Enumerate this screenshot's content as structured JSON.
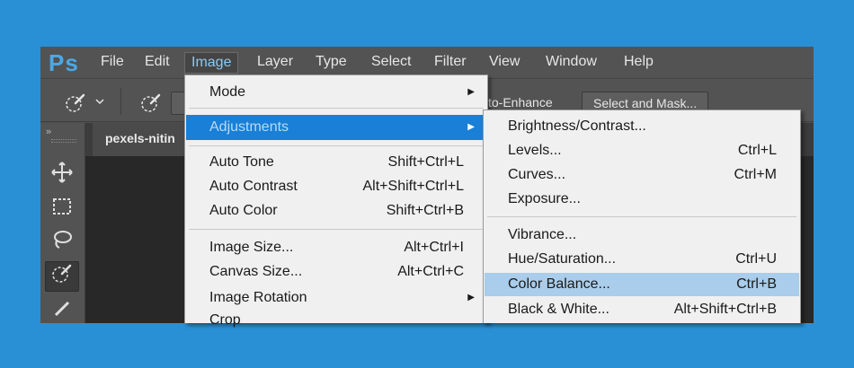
{
  "app": {
    "logo": "Ps"
  },
  "menubar": {
    "items": [
      "File",
      "Edit",
      "Image",
      "Layer",
      "Type",
      "Select",
      "Filter",
      "View",
      "Window",
      "Help"
    ],
    "active": "Image"
  },
  "options_bar": {
    "auto_enhance_partial": "to-Enhance",
    "select_and_mask": "Select and Mask..."
  },
  "document": {
    "tab_title": "pexels-nitin"
  },
  "image_menu": {
    "mode": "Mode",
    "adjustments": "Adjustments",
    "auto_tone": {
      "label": "Auto Tone",
      "shortcut": "Shift+Ctrl+L"
    },
    "auto_contrast": {
      "label": "Auto Contrast",
      "shortcut": "Alt+Shift+Ctrl+L"
    },
    "auto_color": {
      "label": "Auto Color",
      "shortcut": "Shift+Ctrl+B"
    },
    "image_size": {
      "label": "Image Size...",
      "shortcut": "Alt+Ctrl+I"
    },
    "canvas_size": {
      "label": "Canvas Size...",
      "shortcut": "Alt+Ctrl+C"
    },
    "image_rotation": "Image Rotation",
    "crop": "Crop"
  },
  "adjustments_menu": {
    "brightness_contrast": {
      "label": "Brightness/Contrast...",
      "shortcut": ""
    },
    "levels": {
      "label": "Levels...",
      "shortcut": "Ctrl+L"
    },
    "curves": {
      "label": "Curves...",
      "shortcut": "Ctrl+M"
    },
    "exposure": {
      "label": "Exposure...",
      "shortcut": ""
    },
    "vibrance": {
      "label": "Vibrance...",
      "shortcut": ""
    },
    "hue_saturation": {
      "label": "Hue/Saturation...",
      "shortcut": "Ctrl+U"
    },
    "color_balance": {
      "label": "Color Balance...",
      "shortcut": "Ctrl+B"
    },
    "black_white": {
      "label": "Black & White...",
      "shortcut": "Alt+Shift+Ctrl+B"
    }
  },
  "colors": {
    "background": "#2a90d6",
    "menu_highlight": "#1a7fd6",
    "hover_highlight": "#a9cdea",
    "ps_logo": "#4ba9e6"
  },
  "icons": [
    "brush-preset-icon",
    "chevron-down-icon",
    "brush-icon",
    "move-icon",
    "marquee-icon",
    "lasso-icon",
    "quick-select-icon",
    "crop-icon",
    "submenu-arrow-icon"
  ]
}
